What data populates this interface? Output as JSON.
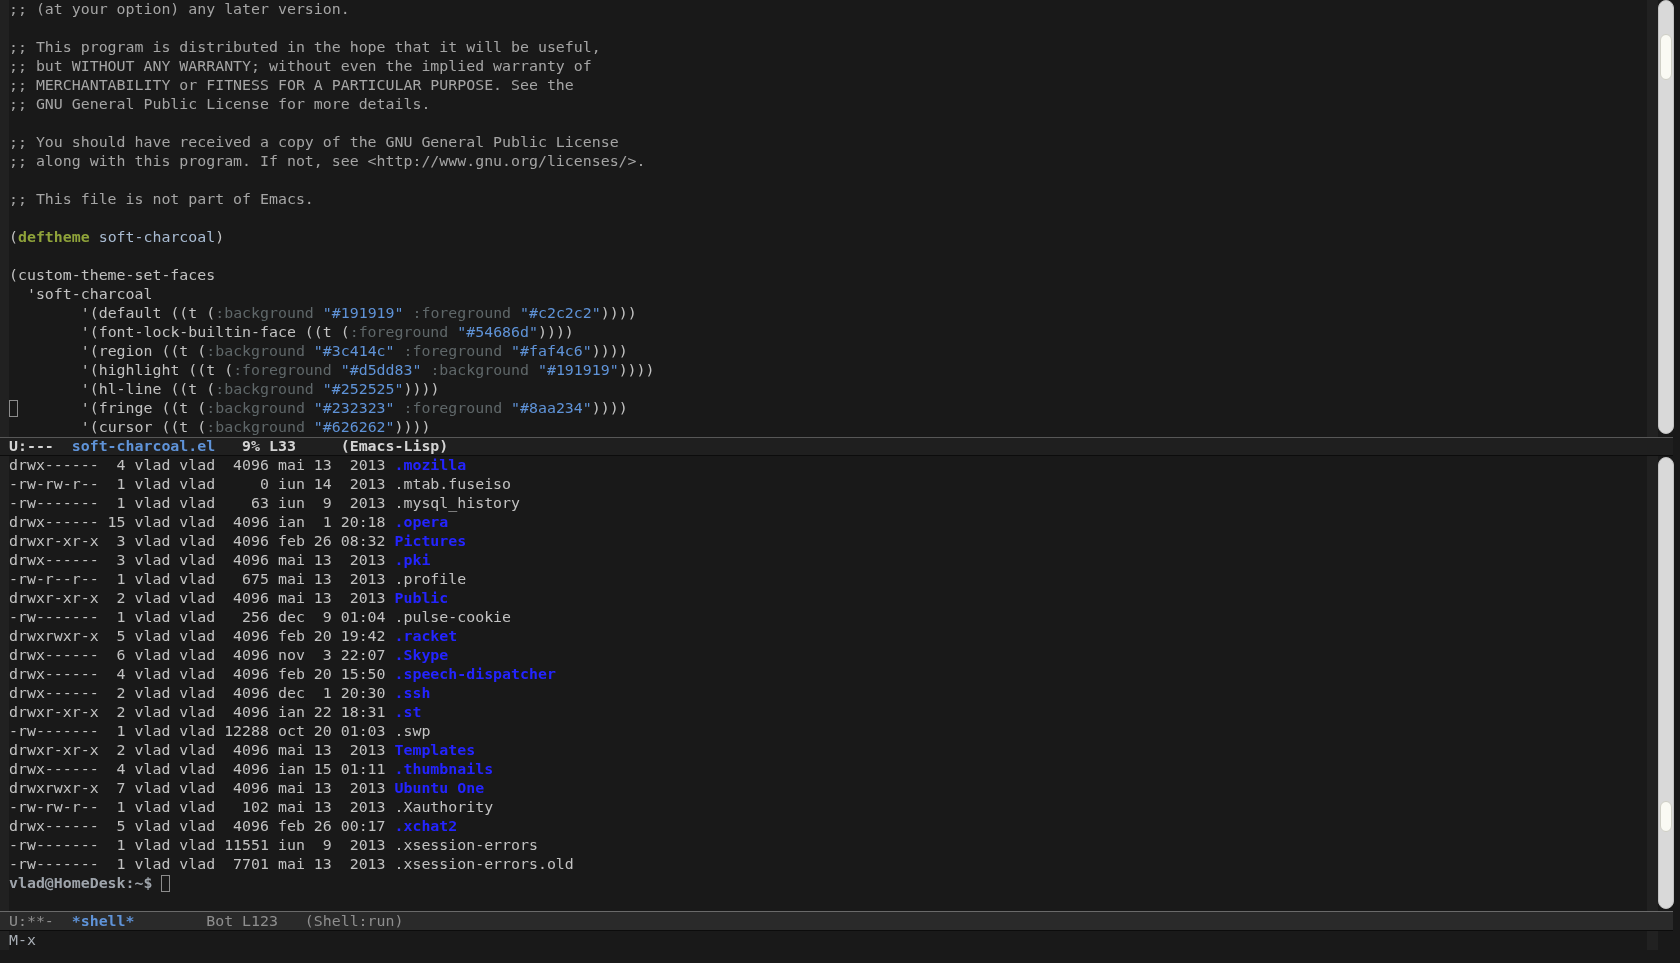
{
  "editor": {
    "lines": [
      {
        "kind": "code",
        "cursor": false,
        "segments": [
          {
            "kind": "comment",
            "text": ";; (at your option) any later version."
          }
        ]
      },
      {
        "kind": "blank"
      },
      {
        "kind": "code",
        "cursor": false,
        "segments": [
          {
            "kind": "comment",
            "text": ";; This program is distributed in the hope that it will be useful,"
          }
        ]
      },
      {
        "kind": "code",
        "cursor": false,
        "segments": [
          {
            "kind": "comment",
            "text": ";; but WITHOUT ANY WARRANTY; without even the implied warranty of"
          }
        ]
      },
      {
        "kind": "code",
        "cursor": false,
        "segments": [
          {
            "kind": "comment",
            "text": ";; MERCHANTABILITY or FITNESS FOR A PARTICULAR PURPOSE. See the"
          }
        ]
      },
      {
        "kind": "code",
        "cursor": false,
        "segments": [
          {
            "kind": "comment",
            "text": ";; GNU General Public License for more details."
          }
        ]
      },
      {
        "kind": "blank"
      },
      {
        "kind": "code",
        "cursor": false,
        "segments": [
          {
            "kind": "comment",
            "text": ";; You should have received a copy of the GNU General Public License"
          }
        ]
      },
      {
        "kind": "code",
        "cursor": false,
        "segments": [
          {
            "kind": "comment",
            "text": ";; along with this program. If not, see <http://www.gnu.org/licenses/>."
          }
        ]
      },
      {
        "kind": "blank"
      },
      {
        "kind": "code",
        "cursor": false,
        "segments": [
          {
            "kind": "comment",
            "text": ";; This file is not part of Emacs."
          }
        ]
      },
      {
        "kind": "blank"
      },
      {
        "kind": "code",
        "cursor": false,
        "segments": [
          {
            "kind": "plain",
            "text": "("
          },
          {
            "kind": "keyword",
            "text": "deftheme"
          },
          {
            "kind": "function",
            "text": " soft-charcoal"
          },
          {
            "kind": "plain",
            "text": ")"
          }
        ]
      },
      {
        "kind": "blank"
      },
      {
        "kind": "code",
        "cursor": false,
        "segments": [
          {
            "kind": "plain",
            "text": "(custom-theme-set-faces"
          }
        ]
      },
      {
        "kind": "code",
        "cursor": false,
        "segments": [
          {
            "kind": "plain",
            "text": "  'soft-charcoal"
          }
        ]
      },
      {
        "kind": "code",
        "cursor": false,
        "segments": [
          {
            "kind": "plain",
            "text": "        '(default ((t ("
          },
          {
            "kind": "builtin",
            "text": ":background "
          },
          {
            "kind": "string",
            "text": "\"#191919\""
          },
          {
            "kind": "builtin",
            "text": " :foreground "
          },
          {
            "kind": "string",
            "text": "\"#c2c2c2\""
          },
          {
            "kind": "plain",
            "text": "))))"
          }
        ]
      },
      {
        "kind": "code",
        "cursor": false,
        "segments": [
          {
            "kind": "plain",
            "text": "        '(font-lock-builtin-face ((t ("
          },
          {
            "kind": "builtin",
            "text": ":foreground "
          },
          {
            "kind": "string",
            "text": "\"#54686d\""
          },
          {
            "kind": "plain",
            "text": "))))"
          }
        ]
      },
      {
        "kind": "code",
        "cursor": false,
        "segments": [
          {
            "kind": "plain",
            "text": "        '(region ((t ("
          },
          {
            "kind": "builtin",
            "text": ":background "
          },
          {
            "kind": "string",
            "text": "\"#3c414c\""
          },
          {
            "kind": "builtin",
            "text": " :foreground "
          },
          {
            "kind": "string",
            "text": "\"#faf4c6\""
          },
          {
            "kind": "plain",
            "text": "))))"
          }
        ]
      },
      {
        "kind": "code",
        "cursor": false,
        "segments": [
          {
            "kind": "plain",
            "text": "        '(highlight ((t ("
          },
          {
            "kind": "builtin",
            "text": ":foreground "
          },
          {
            "kind": "string",
            "text": "\"#d5dd83\""
          },
          {
            "kind": "builtin",
            "text": " :background "
          },
          {
            "kind": "string",
            "text": "\"#191919\""
          },
          {
            "kind": "plain",
            "text": "))))"
          }
        ]
      },
      {
        "kind": "code",
        "cursor": false,
        "segments": [
          {
            "kind": "plain",
            "text": "        '(hl-line ((t ("
          },
          {
            "kind": "builtin",
            "text": ":background "
          },
          {
            "kind": "string",
            "text": "\"#252525\""
          },
          {
            "kind": "plain",
            "text": "))))"
          }
        ]
      },
      {
        "kind": "code",
        "cursor": true,
        "segments": [
          {
            "kind": "plain",
            "text": "        '(fringe ((t ("
          },
          {
            "kind": "builtin",
            "text": ":background "
          },
          {
            "kind": "string",
            "text": "\"#232323\""
          },
          {
            "kind": "builtin",
            "text": " :foreground "
          },
          {
            "kind": "string",
            "text": "\"#8aa234\""
          },
          {
            "kind": "plain",
            "text": "))))"
          }
        ]
      },
      {
        "kind": "code",
        "cursor": false,
        "segments": [
          {
            "kind": "plain",
            "text": "        '(cursor ((t ("
          },
          {
            "kind": "builtin",
            "text": ":background "
          },
          {
            "kind": "string",
            "text": "\"#626262\""
          },
          {
            "kind": "plain",
            "text": "))))"
          }
        ]
      }
    ],
    "mode_line": {
      "active": true,
      "status": "U:---",
      "buffer": "soft-charcoal.el",
      "position": "9% L33",
      "mode": "(Emacs-Lisp)"
    }
  },
  "shell": {
    "rows": [
      {
        "details": "drwx------  4 vlad vlad  4096 mai 13  2013",
        "name": ".mozilla",
        "kind": "directory"
      },
      {
        "details": "-rw-rw-r--  1 vlad vlad     0 iun 14  2013",
        "name": ".mtab.fuseiso",
        "kind": "file"
      },
      {
        "details": "-rw-------  1 vlad vlad    63 iun  9  2013",
        "name": ".mysql_history",
        "kind": "file"
      },
      {
        "details": "drwx------ 15 vlad vlad  4096 ian  1 20:18",
        "name": ".opera",
        "kind": "directory"
      },
      {
        "details": "drwxr-xr-x  3 vlad vlad  4096 feb 26 08:32",
        "name": "Pictures",
        "kind": "directory"
      },
      {
        "details": "drwx------  3 vlad vlad  4096 mai 13  2013",
        "name": ".pki",
        "kind": "directory"
      },
      {
        "details": "-rw-r--r--  1 vlad vlad   675 mai 13  2013",
        "name": ".profile",
        "kind": "file"
      },
      {
        "details": "drwxr-xr-x  2 vlad vlad  4096 mai 13  2013",
        "name": "Public",
        "kind": "directory"
      },
      {
        "details": "-rw-------  1 vlad vlad   256 dec  9 01:04",
        "name": ".pulse-cookie",
        "kind": "file"
      },
      {
        "details": "drwxrwxr-x  5 vlad vlad  4096 feb 20 19:42",
        "name": ".racket",
        "kind": "directory"
      },
      {
        "details": "drwx------  6 vlad vlad  4096 nov  3 22:07",
        "name": ".Skype",
        "kind": "directory"
      },
      {
        "details": "drwx------  4 vlad vlad  4096 feb 20 15:50",
        "name": ".speech-dispatcher",
        "kind": "directory"
      },
      {
        "details": "drwx------  2 vlad vlad  4096 dec  1 20:30",
        "name": ".ssh",
        "kind": "directory"
      },
      {
        "details": "drwxr-xr-x  2 vlad vlad  4096 ian 22 18:31",
        "name": ".st",
        "kind": "directory"
      },
      {
        "details": "-rw-------  1 vlad vlad 12288 oct 20 01:03",
        "name": ".swp",
        "kind": "file"
      },
      {
        "details": "drwxr-xr-x  2 vlad vlad  4096 mai 13  2013",
        "name": "Templates",
        "kind": "directory"
      },
      {
        "details": "drwx------  4 vlad vlad  4096 ian 15 01:11",
        "name": ".thumbnails",
        "kind": "directory"
      },
      {
        "details": "drwxrwxr-x  7 vlad vlad  4096 mai 13  2013",
        "name": "Ubuntu One",
        "kind": "directory"
      },
      {
        "details": "-rw-rw-r--  1 vlad vlad   102 mai 13  2013",
        "name": ".Xauthority",
        "kind": "file"
      },
      {
        "details": "drwx------  5 vlad vlad  4096 feb 26 00:17",
        "name": ".xchat2",
        "kind": "directory"
      },
      {
        "details": "-rw-------  1 vlad vlad 11551 iun  9  2013",
        "name": ".xsession-errors",
        "kind": "file"
      },
      {
        "details": "-rw-------  1 vlad vlad  7701 mai 13  2013",
        "name": ".xsession-errors.old",
        "kind": "file"
      }
    ],
    "prompt": {
      "text": "vlad@HomeDesk:~$",
      "cursor": true
    },
    "mode_line": {
      "active": false,
      "status": "U:**-",
      "buffer": "*shell*",
      "position": "Bot L123",
      "mode": "(Shell:run)"
    }
  },
  "echo_area": {
    "text": "M-x"
  }
}
